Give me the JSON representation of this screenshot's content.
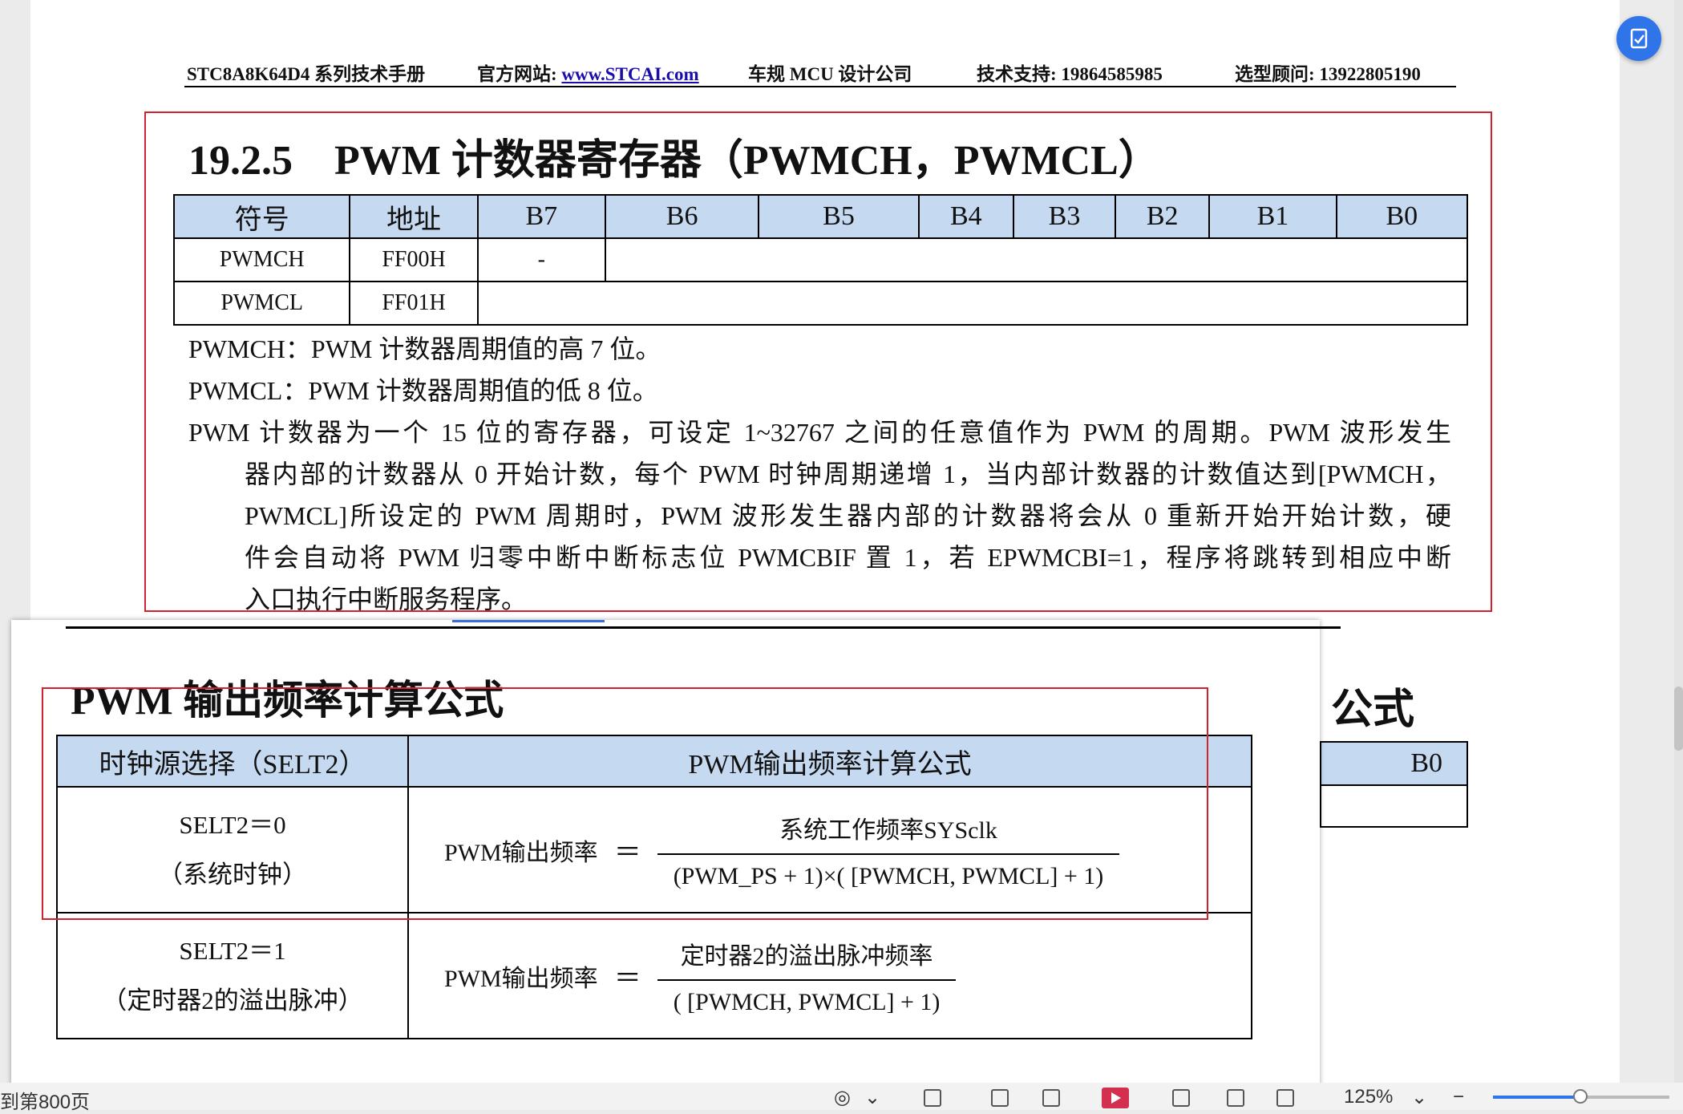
{
  "header": {
    "doc_name": "STC8A8K64D4 系列技术手册",
    "website_label": "官方网站:",
    "website_link": "www.STCAI.com",
    "company": "车规 MCU 设计公司",
    "support": "技术支持: 19864585985",
    "consultant": "选型顾问: 13922805190"
  },
  "section": {
    "title": "19.2.5　PWM 计数器寄存器（PWMCH，PWMCL）"
  },
  "register_table": {
    "headers": [
      "符号",
      "地址",
      "B7",
      "B6",
      "B5",
      "B4",
      "B3",
      "B2",
      "B1",
      "B0"
    ],
    "rows": [
      {
        "symbol": "PWMCH",
        "address": "FF00H",
        "b7": "-"
      },
      {
        "symbol": "PWMCL",
        "address": "FF01H"
      }
    ]
  },
  "description": {
    "pwmch": "PWMCH：PWM 计数器周期值的高 7 位。",
    "pwmcl": "PWMCL：PWM 计数器周期值的低 8 位。",
    "line1": "PWM 计数器为一个 15 位的寄存器，可设定 1~32767 之间的任意值作为 PWM 的周期。PWM 波形发生",
    "line2": "器内部的计数器从 0 开始计数，每个 PWM 时钟周期递增 1，当内部计数器的计数值达到[PWMCH，",
    "line3": "PWMCL]所设定的 PWM 周期时，PWM 波形发生器内部的计数器将会从 0 重新开始开始计数，硬",
    "line4": "件会自动将 PWM 归零中断中断标志位 PWMCBIF 置 1，若 EPWMCBI=1，程序将跳转到相应中断",
    "line5": "入口执行中断服务程序。"
  },
  "overlay": {
    "title": "PWM 输出频率计算公式",
    "table": {
      "headers": [
        "时钟源选择（SELT2）",
        "PWM输出频率计算公式"
      ],
      "rows": [
        {
          "sel_line1": "SELT2＝0",
          "sel_line2": "（系统时钟）",
          "label": "PWM输出频率",
          "eq": "＝",
          "numerator": "系统工作频率SYSclk",
          "denominator": "(PWM_PS + 1)×( [PWMCH, PWMCL] + 1)"
        },
        {
          "sel_line1": "SELT2＝1",
          "sel_line2": "（定时器2的溢出脉冲）",
          "label": "PWM输出频率",
          "eq": "＝",
          "numerator": "定时器2的溢出脉冲频率",
          "denominator": "( [PWMCH, PWMCL] + 1)"
        }
      ]
    }
  },
  "behind": {
    "title_fragment": "公式",
    "table_header": "B0"
  },
  "statusbar": {
    "page_text": "到第800页",
    "zoom": "125%",
    "zoom_fraction": 0.5
  },
  "colors": {
    "table_header_bg": "#c5d9f1",
    "highlight_border": "#d1222e",
    "accent": "#2f74e8"
  },
  "icons": [
    "float-doc-icon",
    "eye-icon",
    "chevron-down-icon",
    "page-view-icon",
    "play-icon",
    "fit-icon"
  ]
}
